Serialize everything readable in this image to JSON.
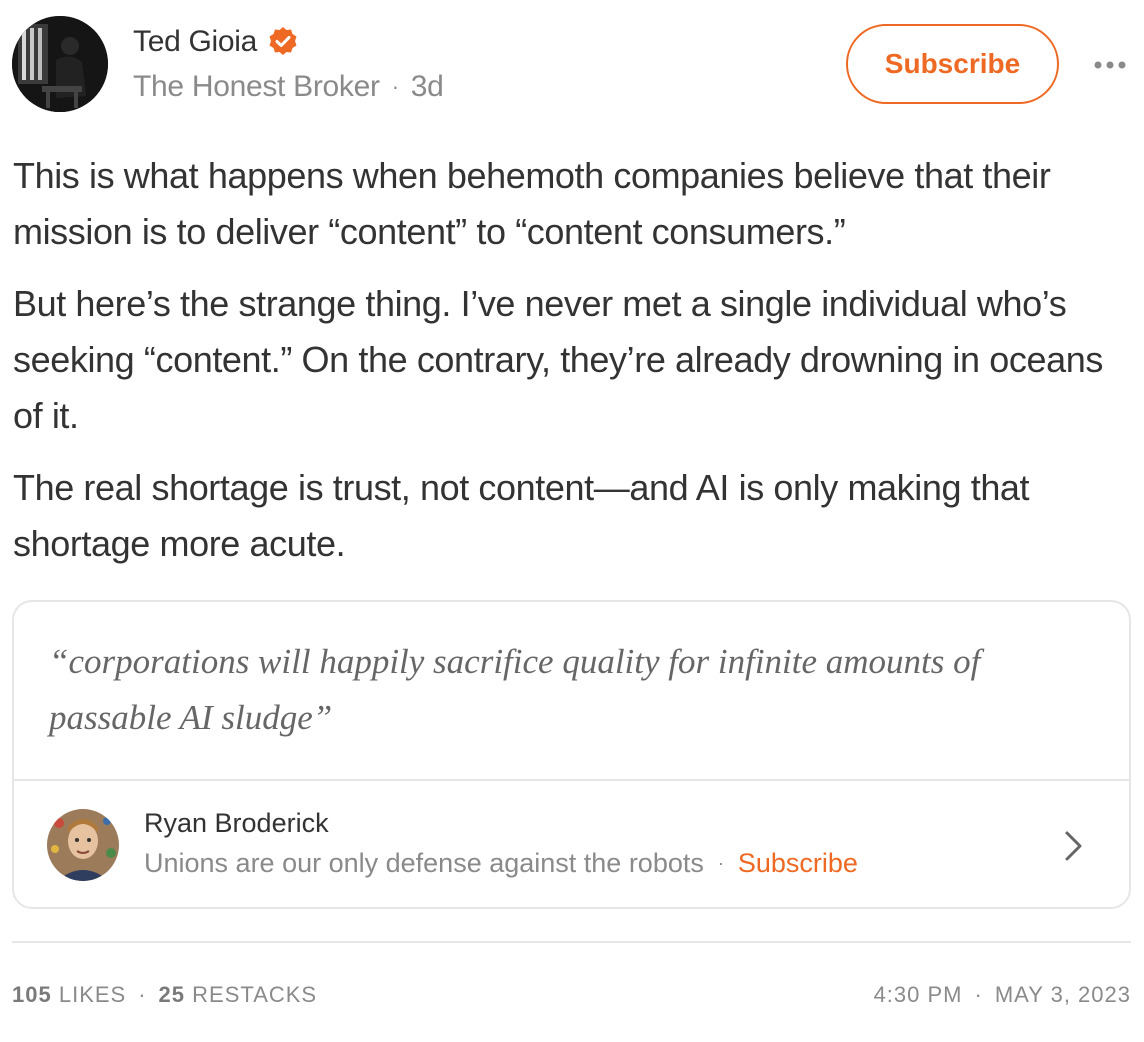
{
  "author": {
    "name": "Ted Gioia",
    "publication": "The Honest Broker",
    "time_ago": "3d",
    "verified_icon": "verified-check-icon",
    "avatar_icon": "author-avatar"
  },
  "header": {
    "subscribe_label": "Subscribe",
    "more_icon": "more-horizontal-icon"
  },
  "post": {
    "paragraphs": [
      "This is what happens when behemoth companies believe that their mission is to deliver “content” to “content consumers.”",
      "But here’s the strange thing. I’ve never met a single individual who’s seeking “content.” On the contrary, they’re already drowning in oceans of it.",
      "The real shortage is trust, not content—and AI is only making that shortage more acute."
    ]
  },
  "quote": {
    "text": "“corporations will happily sacrifice quality for infinite amounts of passable AI sludge”",
    "author": "Ryan Broderick",
    "publication": "Unions are our only defense against the robots",
    "subscribe_label": "Subscribe",
    "chevron_icon": "chevron-right-icon"
  },
  "footer": {
    "likes_count": "105",
    "likes_label": "LIKES",
    "restacks_count": "25",
    "restacks_label": "RESTACKS",
    "time": "4:30 PM",
    "date": "MAY 3, 2023",
    "separator": "·"
  },
  "colors": {
    "accent": "#ee6a24",
    "text": "#333333",
    "muted": "#8a8a8a",
    "border": "#e6e6e6"
  }
}
